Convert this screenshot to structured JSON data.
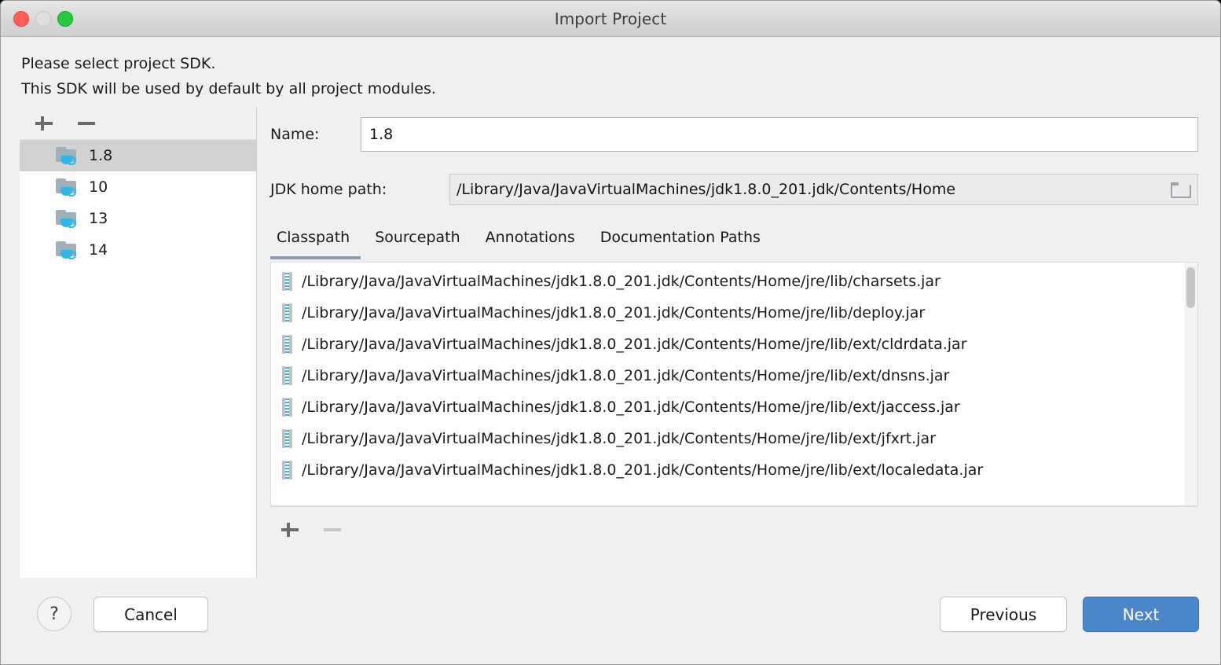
{
  "window": {
    "title": "Import Project",
    "traffic_lights": [
      "close-button",
      "minimize-button",
      "maximize-button"
    ]
  },
  "header": {
    "line1": "Please select project SDK.",
    "line2": "This SDK will be used by default by all project modules."
  },
  "sdk_panel": {
    "toolbar": {
      "add_label": "+",
      "remove_label": "−"
    },
    "items": [
      {
        "label": "1.8",
        "selected": true
      },
      {
        "label": "10",
        "selected": false
      },
      {
        "label": "13",
        "selected": false
      },
      {
        "label": "14",
        "selected": false
      }
    ]
  },
  "details": {
    "name_label": "Name:",
    "name_value": "1.8",
    "path_label": "JDK home path:",
    "path_value": "/Library/Java/JavaVirtualMachines/jdk1.8.0_201.jdk/Contents/Home",
    "browse_icon": "folder-icon"
  },
  "tabs": [
    {
      "label": "Classpath",
      "active": true
    },
    {
      "label": "Sourcepath",
      "active": false
    },
    {
      "label": "Annotations",
      "active": false
    },
    {
      "label": "Documentation Paths",
      "active": false
    }
  ],
  "classpath": {
    "entries": [
      "/Library/Java/JavaVirtualMachines/jdk1.8.0_201.jdk/Contents/Home/jre/lib/charsets.jar",
      "/Library/Java/JavaVirtualMachines/jdk1.8.0_201.jdk/Contents/Home/jre/lib/deploy.jar",
      "/Library/Java/JavaVirtualMachines/jdk1.8.0_201.jdk/Contents/Home/jre/lib/ext/cldrdata.jar",
      "/Library/Java/JavaVirtualMachines/jdk1.8.0_201.jdk/Contents/Home/jre/lib/ext/dnsns.jar",
      "/Library/Java/JavaVirtualMachines/jdk1.8.0_201.jdk/Contents/Home/jre/lib/ext/jaccess.jar",
      "/Library/Java/JavaVirtualMachines/jdk1.8.0_201.jdk/Contents/Home/jre/lib/ext/jfxrt.jar",
      "/Library/Java/JavaVirtualMachines/jdk1.8.0_201.jdk/Contents/Home/jre/lib/ext/localedata.jar"
    ],
    "toolbar": {
      "add_label": "+",
      "remove_label": "−",
      "remove_disabled": true
    }
  },
  "footer": {
    "help_label": "?",
    "cancel_label": "Cancel",
    "previous_label": "Previous",
    "next_label": "Next"
  },
  "colors": {
    "accent_blue": "#4a86c8",
    "tab_underline": "#8d9cb2",
    "selection_gray": "#d2d2d2",
    "jar_cyan": "#36b6e8",
    "folder_gray": "#9fb0bb"
  }
}
